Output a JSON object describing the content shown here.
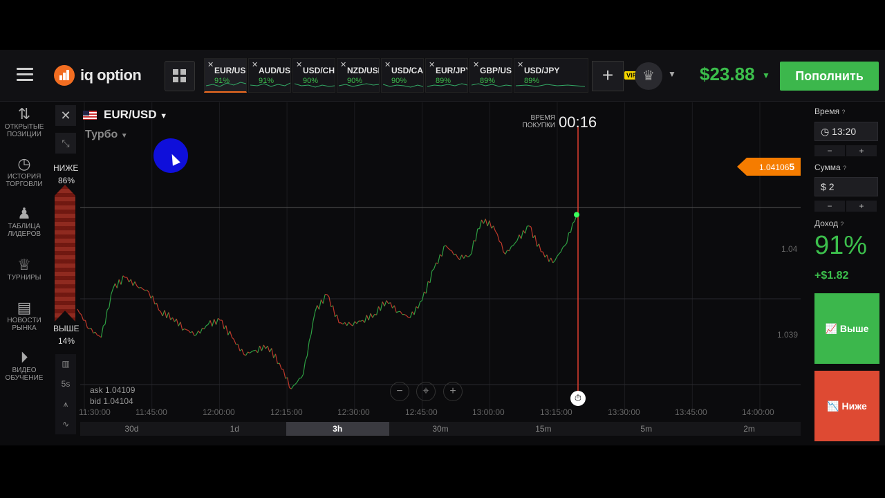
{
  "app": {
    "logo": "iq option"
  },
  "topbar": {
    "tabs": [
      {
        "symbol": "EUR/USD",
        "pct": "91%",
        "active": true
      },
      {
        "symbol": "AUD/USD",
        "pct": "91%"
      },
      {
        "symbol": "USD/CHF",
        "pct": "90%"
      },
      {
        "symbol": "NZD/USD",
        "pct": "90%"
      },
      {
        "symbol": "USD/CAD",
        "pct": "90%"
      },
      {
        "symbol": "EUR/JPY",
        "pct": "89%"
      },
      {
        "symbol": "GBP/USD",
        "pct": "89%"
      },
      {
        "symbol": "USD/JPY",
        "pct": "89%"
      }
    ],
    "add": "+",
    "vip": "VIP",
    "balance": "$23.88",
    "deposit": "Пополнить"
  },
  "sidebar": {
    "items": [
      {
        "icon": "sort-arrows-icon",
        "label": "ОТКРЫТЫЕ ПОЗИЦИИ"
      },
      {
        "icon": "history-icon",
        "label": "ИСТОРИЯ ТОРГОВЛИ"
      },
      {
        "icon": "leaderboard-icon",
        "label": "ТАБЛИЦА ЛИДЕРОВ"
      },
      {
        "icon": "trophy-icon",
        "label": "ТУРНИРЫ"
      },
      {
        "icon": "news-icon",
        "label": "НОВОСТИ РЫНКА"
      },
      {
        "icon": "play-icon",
        "label": "ВИДЕО ОБУЧЕНИЕ"
      }
    ]
  },
  "chart_header": {
    "pair": "EUR/USD",
    "mode": "Турбо",
    "lower_label": "НИЖЕ",
    "lower_pct": "86%",
    "higher_label": "ВЫШЕ",
    "higher_pct": "14%",
    "purchase_label_1": "ВРЕМЯ",
    "purchase_label_2": "ПОКУПКИ",
    "timer": "00:16",
    "price_prefix": "1.04106",
    "price_last": "5",
    "ask": "ask 1.04109",
    "bid": "bid 1.04104",
    "tool_period": "5s"
  },
  "chart_data": {
    "type": "line",
    "x_ticks": [
      "11:30:00",
      "11:45:00",
      "12:00:00",
      "12:15:00",
      "12:30:00",
      "12:45:00",
      "13:00:00",
      "13:15:00",
      "13:30:00",
      "13:45:00",
      "14:00:00"
    ],
    "y_ticks": [
      "1.04",
      "1.039"
    ],
    "current_price": 1.041065,
    "series": [
      {
        "values": [
          1.03988,
          1.03965,
          1.03955,
          1.04012,
          1.04025,
          1.04015,
          1.04008,
          1.03985,
          1.03978,
          1.03965,
          1.03958,
          1.0397,
          1.03975,
          1.03955,
          1.03935,
          1.0394,
          1.03945,
          1.03925,
          1.03895,
          1.03912,
          1.03985,
          1.04005,
          1.03972,
          1.0397,
          1.03975,
          1.03982,
          1.03998,
          1.03985,
          1.03978,
          1.03998,
          1.04035,
          1.04062,
          1.04048,
          1.0405,
          1.04092,
          1.04085,
          1.04052,
          1.04068,
          1.04085,
          1.04055,
          1.04042,
          1.04062,
          1.04098
        ]
      }
    ],
    "periods": [
      "30d",
      "1d",
      "3h",
      "30m",
      "15m",
      "5m",
      "2m"
    ],
    "active_period": "3h"
  },
  "right_panel": {
    "time_label": "Время",
    "time_value": "13:20",
    "amount_label": "Сумма",
    "amount_currency": "$",
    "amount_value": "2",
    "minus": "−",
    "plus": "+",
    "profit_label": "Доход",
    "profit_pct": "91%",
    "profit_amount": "+$1.82",
    "up_button": "Выше",
    "down_button": "Ниже"
  },
  "colors": {
    "accent_green": "#3cb74c",
    "accent_red": "#de4a33",
    "accent_orange": "#f26d21"
  }
}
